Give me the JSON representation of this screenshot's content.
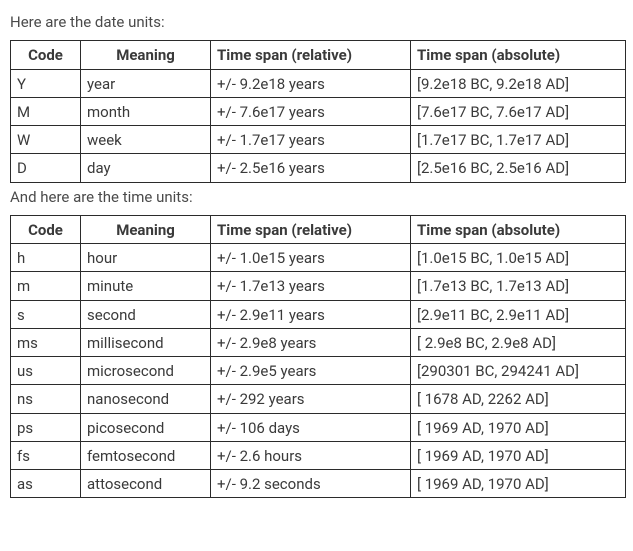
{
  "intro_date": "Here are the date units:",
  "intro_time": "And here are the time units:",
  "headers": {
    "code": "Code",
    "meaning": "Meaning",
    "relative": "Time span (relative)",
    "absolute": "Time span (absolute)"
  },
  "date_units": [
    {
      "code": "Y",
      "meaning": "year",
      "relative": "+/- 9.2e18 years",
      "absolute": "[9.2e18 BC, 9.2e18 AD]"
    },
    {
      "code": "M",
      "meaning": "month",
      "relative": "+/- 7.6e17 years",
      "absolute": "[7.6e17 BC, 7.6e17 AD]"
    },
    {
      "code": "W",
      "meaning": "week",
      "relative": "+/- 1.7e17 years",
      "absolute": "[1.7e17 BC, 1.7e17 AD]"
    },
    {
      "code": "D",
      "meaning": "day",
      "relative": "+/- 2.5e16 years",
      "absolute": "[2.5e16 BC, 2.5e16 AD]"
    }
  ],
  "time_units": [
    {
      "code": "h",
      "meaning": "hour",
      "relative": "+/- 1.0e15 years",
      "absolute": "[1.0e15 BC, 1.0e15 AD]"
    },
    {
      "code": "m",
      "meaning": "minute",
      "relative": "+/- 1.7e13 years",
      "absolute": "[1.7e13 BC, 1.7e13 AD]"
    },
    {
      "code": "s",
      "meaning": "second",
      "relative": "+/- 2.9e11 years",
      "absolute": "[2.9e11 BC, 2.9e11 AD]"
    },
    {
      "code": "ms",
      "meaning": "millisecond",
      "relative": "+/- 2.9e8 years",
      "absolute": "[ 2.9e8 BC, 2.9e8 AD]"
    },
    {
      "code": "us",
      "meaning": "microsecond",
      "relative": "+/- 2.9e5 years",
      "absolute": "[290301 BC, 294241 AD]"
    },
    {
      "code": "ns",
      "meaning": "nanosecond",
      "relative": "+/- 292 years",
      "absolute": "[ 1678 AD, 2262 AD]"
    },
    {
      "code": "ps",
      "meaning": "picosecond",
      "relative": "+/- 106 days",
      "absolute": "[ 1969 AD, 1970 AD]"
    },
    {
      "code": "fs",
      "meaning": "femtosecond",
      "relative": "+/- 2.6 hours",
      "absolute": "[ 1969 AD, 1970 AD]"
    },
    {
      "code": "as",
      "meaning": "attosecond",
      "relative": "+/- 9.2 seconds",
      "absolute": "[ 1969 AD, 1970 AD]"
    }
  ]
}
